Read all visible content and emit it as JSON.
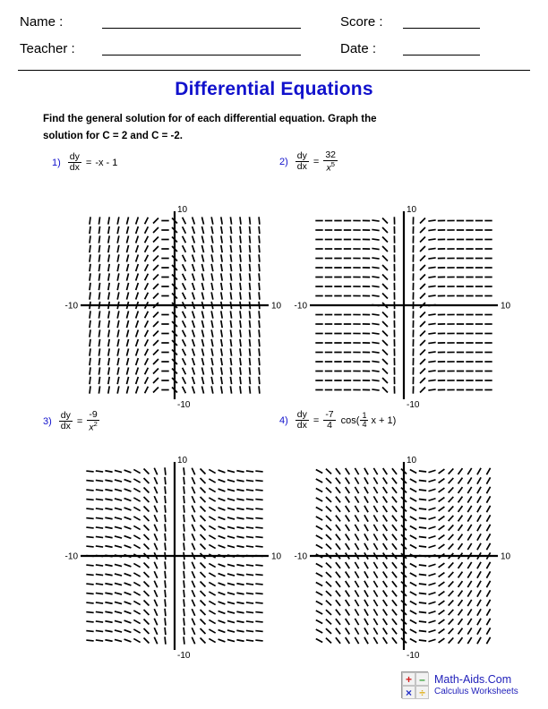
{
  "header": {
    "name_label": "Name :",
    "teacher_label": "Teacher :",
    "score_label": "Score :",
    "date_label": "Date :",
    "name_value": "",
    "teacher_value": "",
    "score_value": "",
    "date_value": ""
  },
  "title": "Differential Equations",
  "instructions": "Find the general solution for of each differential equation. Graph the solution for C = 2 and C = -2.",
  "title_color": "#1111cc",
  "problems": [
    {
      "number": "1)",
      "lhs_num": "dy",
      "lhs_den": "dx",
      "equals": "=",
      "rhs_text": "-x - 1",
      "rhs_type": "plain"
    },
    {
      "number": "2)",
      "lhs_num": "dy",
      "lhs_den": "dx",
      "equals": "=",
      "rhs_type": "fraction",
      "rhs_num": "32",
      "rhs_den_base": "x",
      "rhs_den_exp": "5"
    },
    {
      "number": "3)",
      "lhs_num": "dy",
      "lhs_den": "dx",
      "equals": "=",
      "rhs_type": "fraction",
      "rhs_num": "-9",
      "rhs_den_base": "x",
      "rhs_den_exp": "2"
    },
    {
      "number": "4)",
      "lhs_num": "dy",
      "lhs_den": "dx",
      "equals": "=",
      "rhs_type": "coefficient-cosine",
      "coef_num": "-7",
      "coef_den": "4",
      "func_open": "cos(",
      "inner_num": "1",
      "inner_den": "4",
      "inner_var": "x + 1)"
    }
  ],
  "graphs": [
    {
      "id": "graph-1",
      "x_min_label": "-10",
      "x_max_label": "10",
      "y_min_label": "-10",
      "y_max_label": "10",
      "xlim": [
        -10,
        10
      ],
      "ylim": [
        -10,
        10
      ],
      "field": "linear",
      "params": {
        "a": -1,
        "b": -1
      }
    },
    {
      "id": "graph-2",
      "x_min_label": "-10",
      "x_max_label": "10",
      "y_min_label": "-10",
      "y_max_label": "10",
      "xlim": [
        -10,
        10
      ],
      "ylim": [
        -10,
        10
      ],
      "field": "power",
      "params": {
        "k": 32,
        "n": 5
      }
    },
    {
      "id": "graph-3",
      "x_min_label": "-10",
      "x_max_label": "10",
      "y_min_label": "-10",
      "y_max_label": "10",
      "xlim": [
        -10,
        10
      ],
      "ylim": [
        -10,
        10
      ],
      "field": "power",
      "params": {
        "k": -9,
        "n": 2
      }
    },
    {
      "id": "graph-4",
      "x_min_label": "-10",
      "x_max_label": "10",
      "y_min_label": "-10",
      "y_max_label": "10",
      "xlim": [
        -10,
        10
      ],
      "ylim": [
        -10,
        10
      ],
      "field": "cosine",
      "params": {
        "amp": -1.75,
        "freq": 0.25,
        "phase": 1
      }
    }
  ],
  "footer": {
    "logo_cells": [
      "+",
      "–",
      "×",
      "÷"
    ],
    "site": "Math-Aids.Com",
    "subtitle": "Calculus Worksheets"
  }
}
